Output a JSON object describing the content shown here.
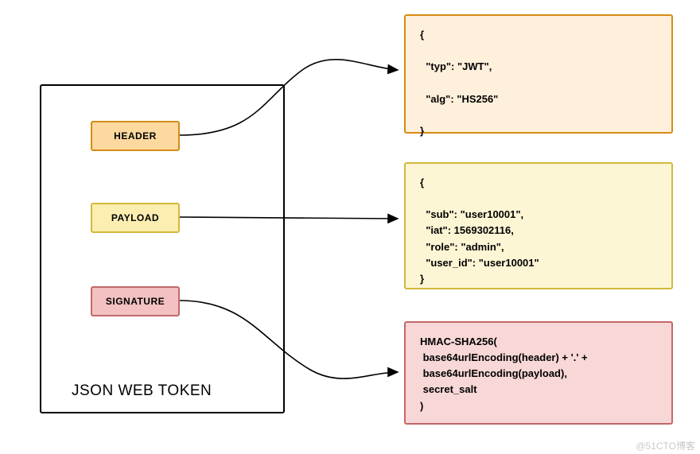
{
  "diagram": {
    "title": "JSON WEB TOKEN",
    "parts": {
      "header_label": "HEADER",
      "payload_label": "PAYLOAD",
      "signature_label": "SIGNATURE"
    },
    "header_block": "{\n\n  \"typ\": \"JWT\",\n\n  \"alg\": \"HS256\"\n\n}",
    "payload_block": "{\n\n  \"sub\": \"user10001\",\n  \"iat\": 1569302116,\n  \"role\": \"admin\",\n  \"user_id\": \"user10001\"\n}",
    "signature_block": "HMAC-SHA256(\n base64urlEncoding(header) + '.' +\n base64urlEncoding(payload),\n secret_salt\n)"
  },
  "watermark": "@51CTO博客"
}
